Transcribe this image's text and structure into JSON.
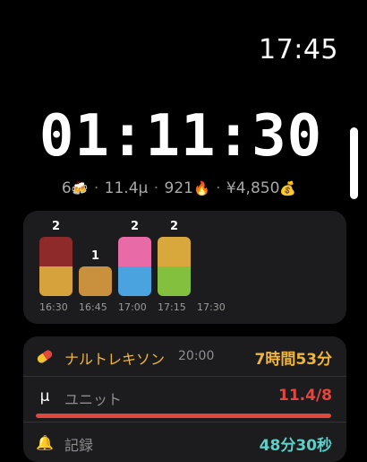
{
  "status_bar": {
    "time": "17:45"
  },
  "timer": {
    "elapsed": "01:11:30"
  },
  "summary": {
    "drinks_count": "6",
    "drinks_icon": "🍻",
    "units": "11.4µ",
    "calories": "921",
    "calories_icon": "🔥",
    "cost": "¥4,850",
    "cost_icon": "💰",
    "separator": "·"
  },
  "chart_data": {
    "type": "bar",
    "x_ticks": [
      "16:30",
      "16:45",
      "17:00",
      "17:15",
      "17:30"
    ],
    "bars": [
      {
        "x": "16:30",
        "count": "2",
        "segments": [
          "#8e2a2a",
          "#d6a23c"
        ]
      },
      {
        "x": "16:45",
        "count": "1",
        "segments": [
          "#c9913e"
        ]
      },
      {
        "x": "17:00",
        "count": "2",
        "segments": [
          "#e86aa6",
          "#4aa3df"
        ]
      },
      {
        "x": "17:15",
        "count": "2",
        "segments": [
          "#d9a83c",
          "#82c03e"
        ]
      }
    ]
  },
  "rows": {
    "naltrexone": {
      "icon": "pill-icon",
      "label": "ナルトレキソン",
      "time": "20:00",
      "value": "7時間53分",
      "value_color": "#f0b53d"
    },
    "units": {
      "icon": "mu-icon",
      "icon_glyph": "µ",
      "label": "ユニット",
      "value": "11.4/8",
      "value_color": "#e8453c",
      "progress": 1.0
    },
    "record": {
      "icon": "bell-icon",
      "icon_glyph": "🔔",
      "label": "記録",
      "value": "48分30秒",
      "value_color": "#5ecfc7"
    }
  }
}
